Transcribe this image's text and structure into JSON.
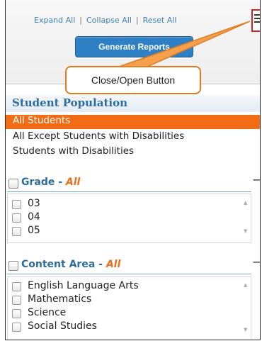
{
  "toolbar": {
    "expand_all": "Expand All",
    "collapse_all": "Collapse All",
    "reset_all": "Reset All",
    "generate_reports": "Generate Reports",
    "menu_icon": "hamburger-icon"
  },
  "callout": {
    "text": "Close/Open Button"
  },
  "population": {
    "title": "Student Population",
    "items": [
      "All Students",
      "All Except Students with Disabilities",
      "Students with Disabilities"
    ],
    "selected": "All Students"
  },
  "grade": {
    "title": "Grade",
    "filter": "All",
    "items": [
      "03",
      "04",
      "05"
    ]
  },
  "content_area": {
    "title": "Content Area",
    "filter": "All",
    "items": [
      "English Language Arts",
      "Mathematics",
      "Science",
      "Social Studies"
    ]
  },
  "colors": {
    "accent": "#f26b15",
    "link": "#3f7fae",
    "button": "#2f7fc4",
    "heading": "#2d6ca2"
  }
}
